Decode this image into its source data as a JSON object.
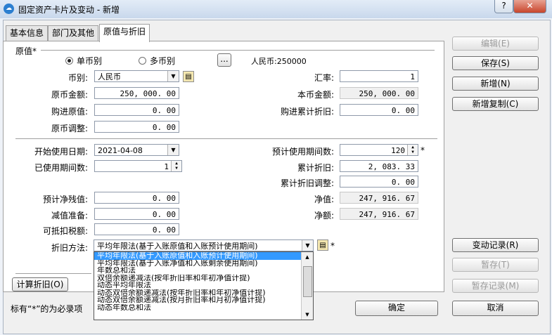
{
  "window": {
    "title": "固定资产卡片及变动 - 新增",
    "help": "?",
    "close": "✕"
  },
  "tabs": [
    {
      "label": "基本信息"
    },
    {
      "label": "部门及其他"
    },
    {
      "label": "原值与折旧",
      "active": true
    }
  ],
  "group": {
    "title": "原值*"
  },
  "currency_mode": {
    "single": "单币别",
    "multi": "多币别",
    "selected": "single",
    "ellipsis": "...",
    "summary": "人民币:250000"
  },
  "fields": {
    "currency": {
      "label": "币别:",
      "value": "人民币"
    },
    "exchange_rate": {
      "label": "汇率:",
      "value": "1"
    },
    "orig_amount": {
      "label": "原币金额:",
      "value": "250, 000. 00"
    },
    "local_amount": {
      "label": "本币金额:",
      "value": "250, 000. 00"
    },
    "purchase_value": {
      "label": "购进原值:",
      "value": "0. 00"
    },
    "purchase_accum_dep": {
      "label": "购进累计折旧:",
      "value": "0. 00"
    },
    "orig_adjust": {
      "label": "原币调整:",
      "value": "0. 00"
    },
    "start_date": {
      "label": "开始使用日期:",
      "value": "2021-04-08"
    },
    "expected_periods": {
      "label": "预计使用期间数:",
      "value": "120",
      "required": "*"
    },
    "used_periods": {
      "label": "已使用期间数:",
      "value": "1"
    },
    "accum_dep": {
      "label": "累计折旧:",
      "value": "2, 083. 33"
    },
    "accum_dep_adjust": {
      "label": "累计折旧调整:",
      "value": "0. 00"
    },
    "expected_salvage": {
      "label": "预计净残值:",
      "value": "0. 00"
    },
    "net_value": {
      "label": "净值:",
      "value": "247, 916. 67"
    },
    "impairment": {
      "label": "减值准备:",
      "value": "0. 00"
    },
    "net_amount": {
      "label": "净额:",
      "value": "247, 916. 67"
    },
    "deductible_tax": {
      "label": "可抵扣税额:",
      "value": "0. 00"
    },
    "dep_method": {
      "label": "折旧方法:",
      "value": "平均年限法(基于入账原值和入账预计使用期间)",
      "required": "*"
    }
  },
  "dep_method_options": [
    "平均年限法(基于入账原值和入账预计使用期间)",
    "平均年限法(基于入账净值和入账剩余使用期间)",
    "年数总和法",
    "双倍余额递减法(按年折旧率和年初净值计提)",
    "动态平均年限法",
    "动态双倍余额递减法(按年折旧率和年初净值计提)",
    "动态双倍余额递减法(按月折旧率和月初净值计提)",
    "动态年数总和法"
  ],
  "dep_method_selected_index": 0,
  "buttons": {
    "edit": "编辑(E)",
    "save": "保存(S)",
    "new": "新增(N)",
    "new_copy": "新增复制(C)",
    "change_log": "变动记录(R)",
    "hold": "暂存(T)",
    "hold_log": "暂存记录(M)",
    "calc_dep": "计算折旧(O)",
    "ok": "确定",
    "cancel": "取消"
  },
  "footer": {
    "note": "标有“*”的为必录项"
  }
}
